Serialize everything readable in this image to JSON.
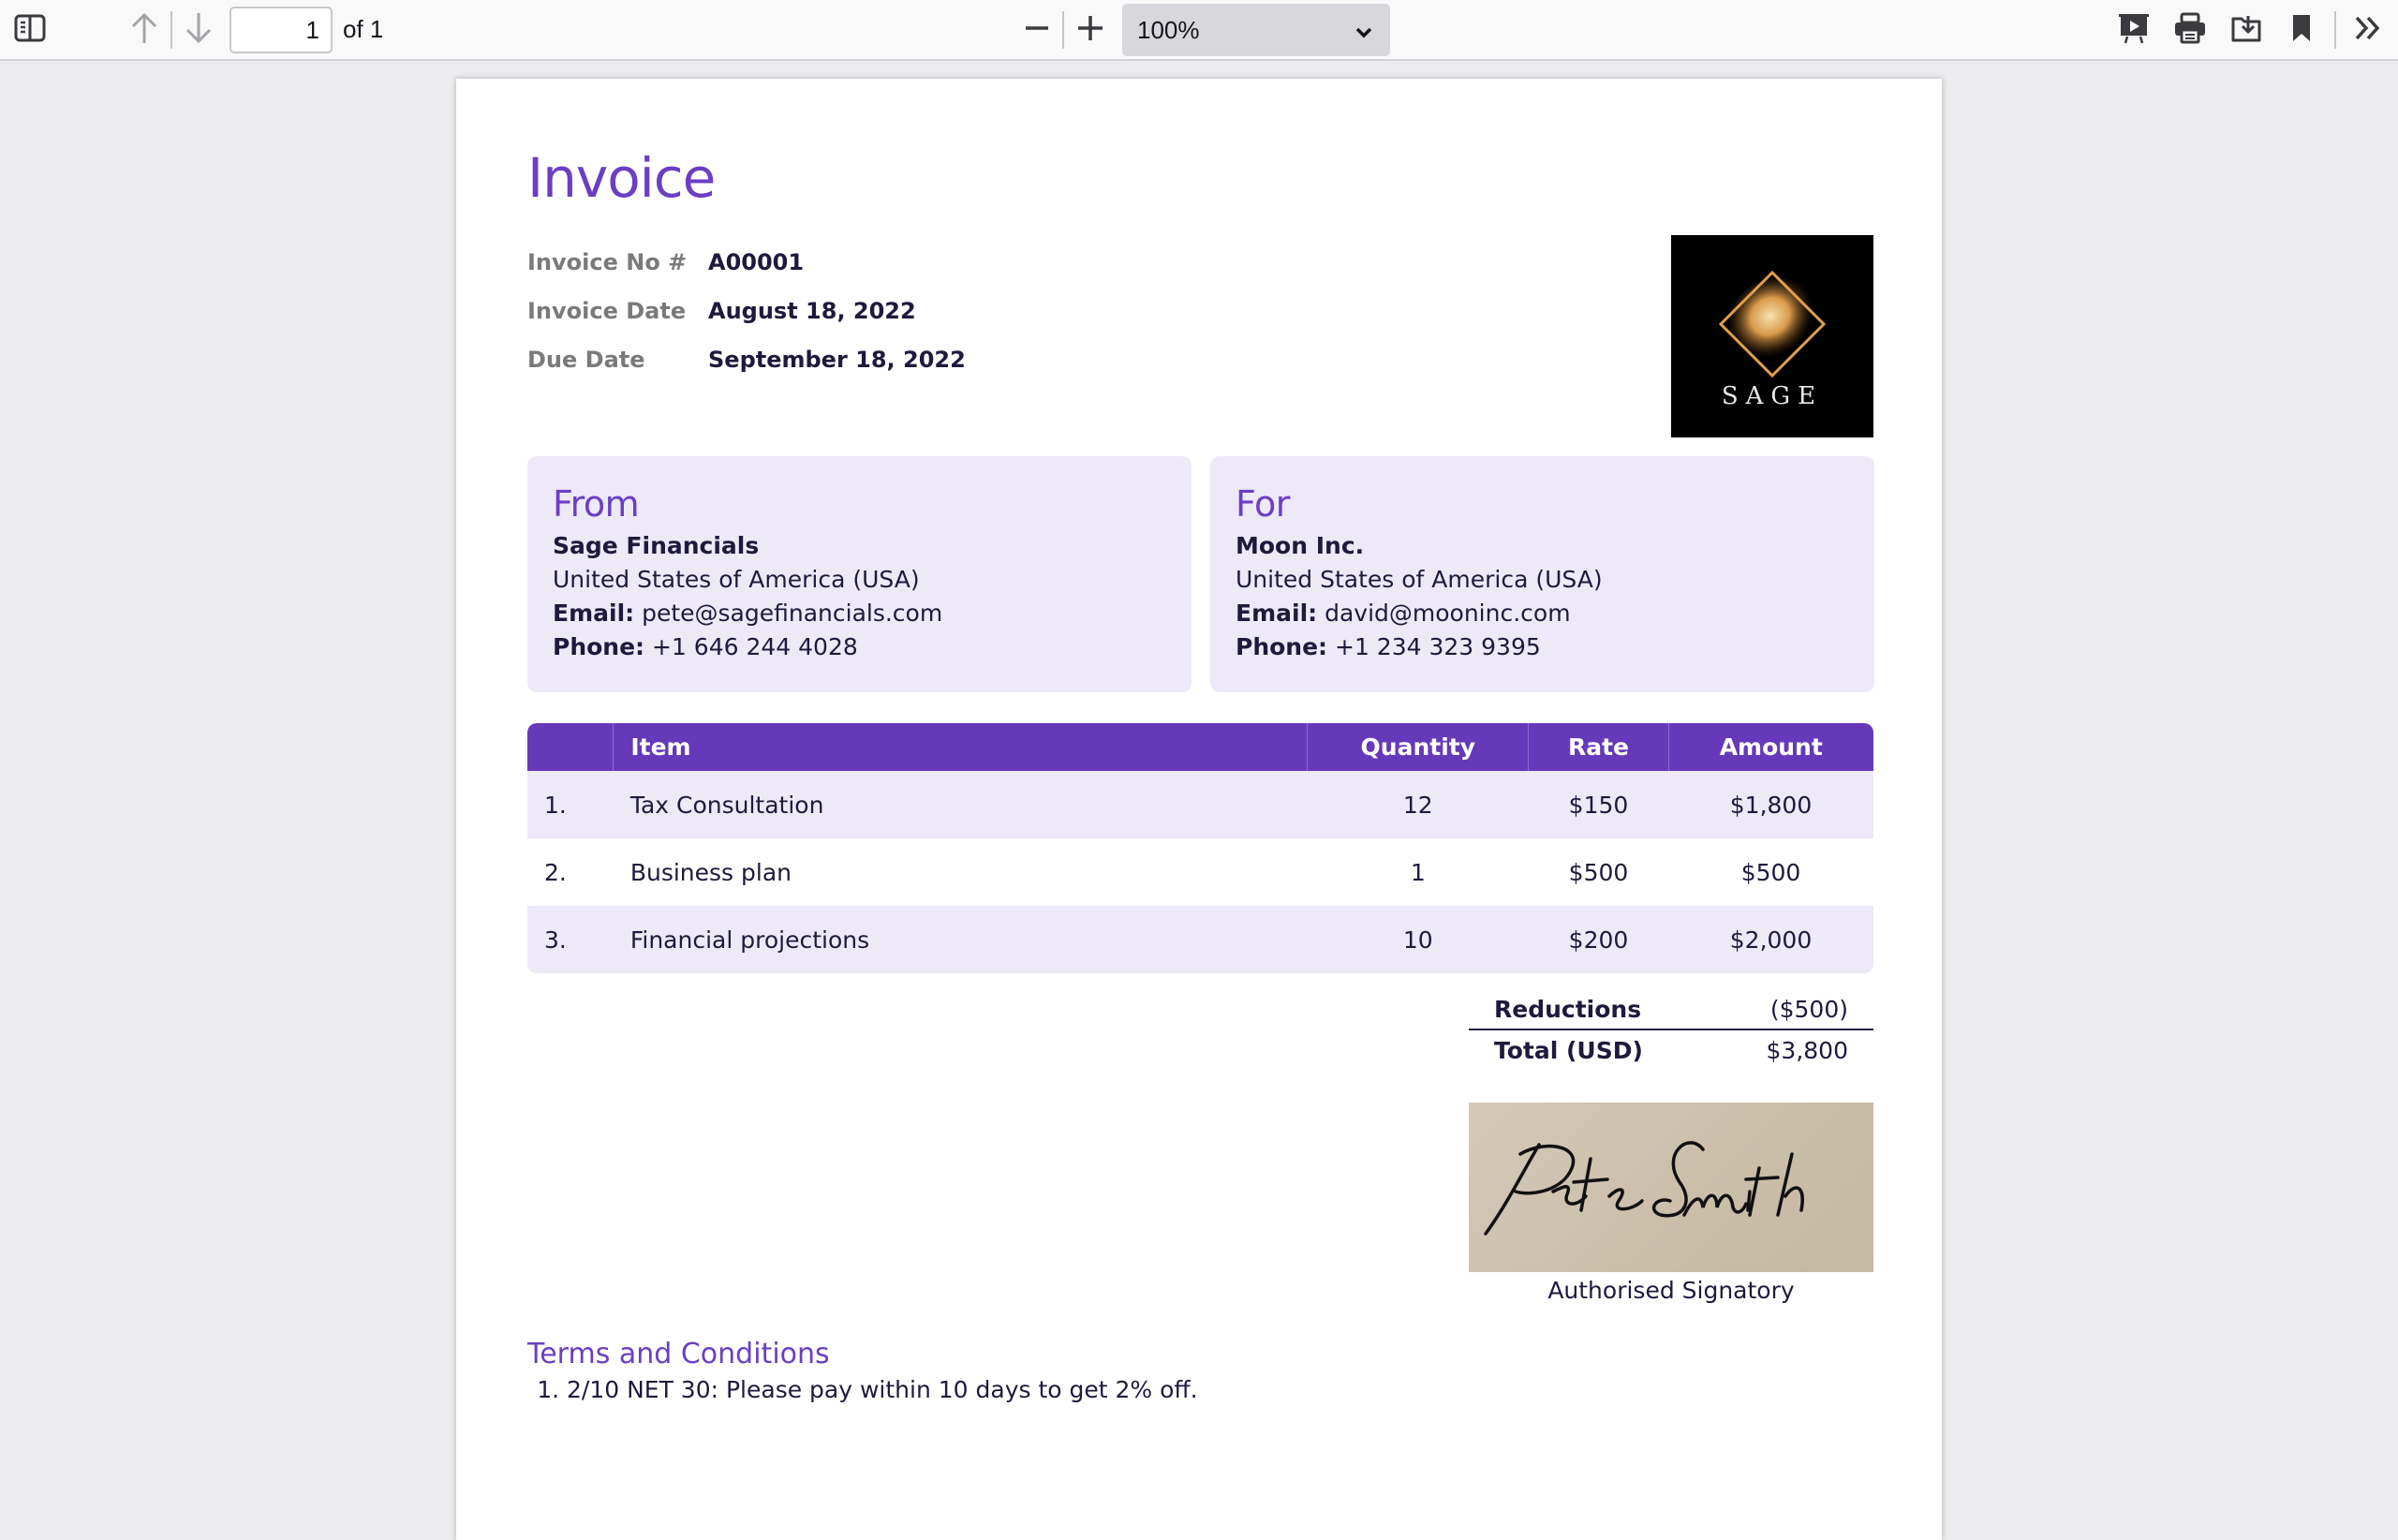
{
  "toolbar": {
    "page_current": "1",
    "page_total_label": "of 1",
    "zoom_value": "100%",
    "icons": {
      "sidebar": "sidebar-toggle-icon",
      "prev": "arrow-up-icon",
      "next": "arrow-down-icon",
      "zoom_out": "minus-icon",
      "zoom_in": "plus-icon",
      "presentation": "presentation-mode-icon",
      "print": "print-icon",
      "save": "save-download-icon",
      "bookmark": "bookmark-icon",
      "more": "double-chevron-right-icon"
    }
  },
  "invoice": {
    "title": "Invoice",
    "meta": [
      {
        "label": "Invoice No #",
        "value": "A00001"
      },
      {
        "label": "Invoice Date",
        "value": "August 18, 2022"
      },
      {
        "label": "Due Date",
        "value": "September 18, 2022"
      }
    ],
    "logo_text": "SAGE",
    "from": {
      "heading": "From",
      "name": "Sage Financials",
      "country": "United States of America (USA)",
      "email_label": "Email:",
      "email": "pete@sagefinancials.com",
      "phone_label": "Phone:",
      "phone": "+1 646 244 4028"
    },
    "for": {
      "heading": "For",
      "name": "Moon Inc.",
      "country": "United States of America (USA)",
      "email_label": "Email:",
      "email": "david@mooninc.com",
      "phone_label": "Phone:",
      "phone": "+1 234 323 9395"
    },
    "table": {
      "headers": [
        "",
        "Item",
        "Quantity",
        "Rate",
        "Amount"
      ],
      "rows": [
        {
          "num": "1.",
          "item": "Tax Consultation",
          "qty": "12",
          "rate": "$150",
          "amount": "$1,800"
        },
        {
          "num": "2.",
          "item": "Business plan",
          "qty": "1",
          "rate": "$500",
          "amount": "$500"
        },
        {
          "num": "3.",
          "item": "Financial projections",
          "qty": "10",
          "rate": "$200",
          "amount": "$2,000"
        }
      ]
    },
    "totals": [
      {
        "label": "Reductions",
        "value": "($500)"
      },
      {
        "label": "Total (USD)",
        "value": "$3,800"
      }
    ],
    "signature_text": "Pete Smith",
    "signature_caption": "Authorised Signatory",
    "terms": {
      "title": "Terms and Conditions",
      "items": [
        "2/10 NET 30: Please pay within 10 days to get 2% off."
      ]
    },
    "colors": {
      "accent": "#6a3fc4",
      "table_header": "#6639ba",
      "box_background": "#ede9f7",
      "text_dark": "#1e1a3c",
      "label_grey": "#7a7a7c"
    }
  }
}
